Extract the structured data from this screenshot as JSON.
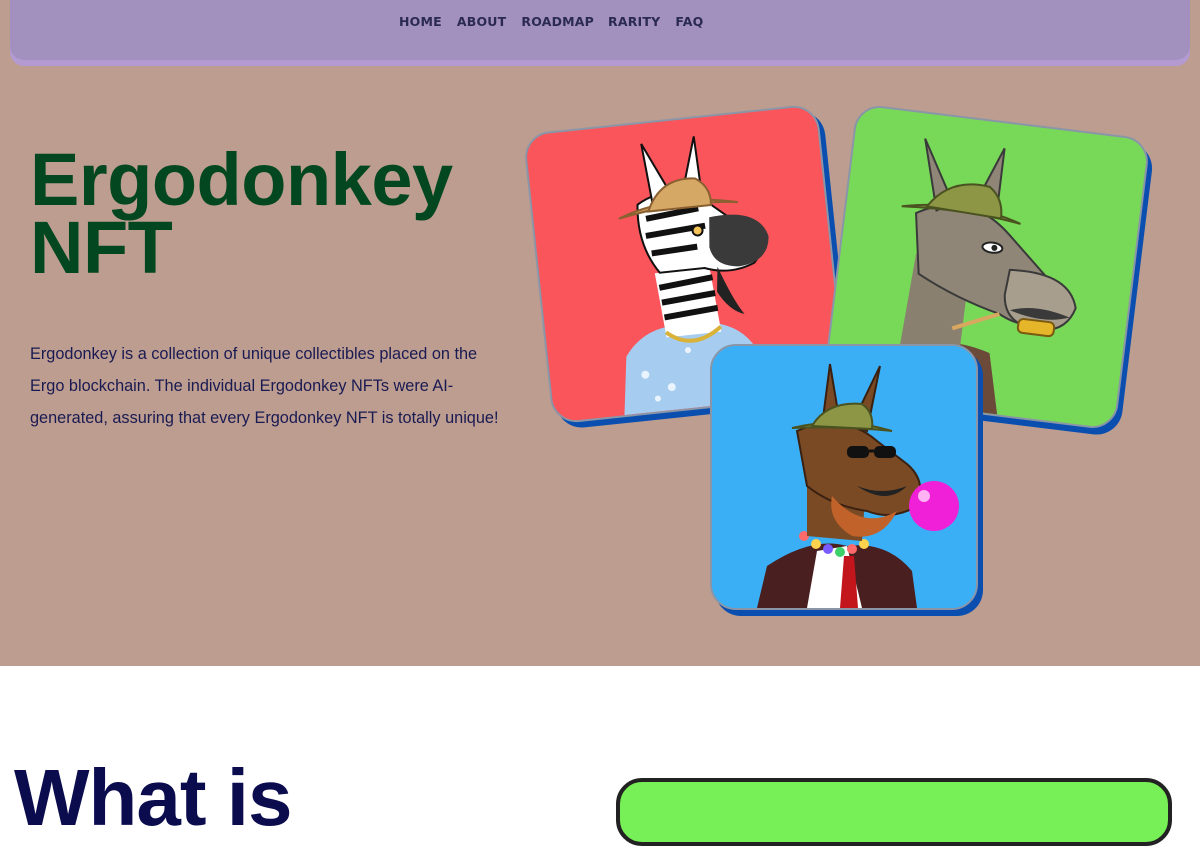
{
  "nav": {
    "items": [
      "HOME",
      "ABOUT",
      "ROADMAP",
      "RARITY",
      "FAQ"
    ]
  },
  "hero": {
    "title_line1": "Ergodonkey",
    "title_line2": "NFT",
    "description": "Ergodonkey is a collection of unique collectibles placed on the Ergo blockchain. The individual Ergodonkey NFTs were AI-generated, assuring that every Ergodonkey NFT is totally unique!",
    "cards": [
      {
        "subject": "zebra-nft-image",
        "background": "#f9555b"
      },
      {
        "subject": "donkey-green-nft-image",
        "background": "#78d857"
      },
      {
        "subject": "donkey-blue-nft-image",
        "background": "#3baff6"
      }
    ]
  },
  "section2": {
    "title": "What is"
  },
  "colors": {
    "nav_bg": "#a290bf",
    "hero_bg": "#bc9d90",
    "title_green": "#02471f",
    "text_navy": "#1a1a52",
    "card_shadow": "#0a4fb0"
  }
}
